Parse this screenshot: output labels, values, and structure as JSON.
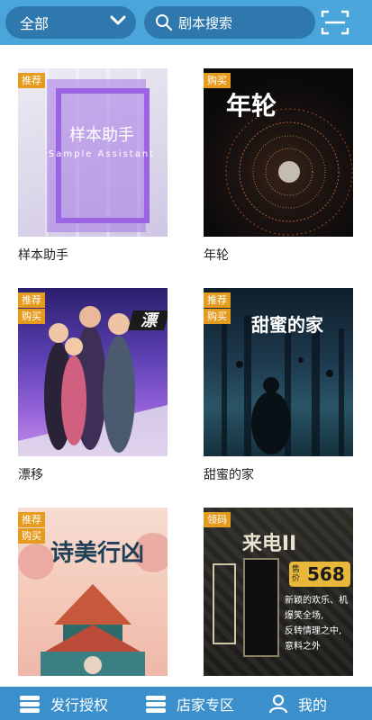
{
  "header": {
    "category_label": "全部",
    "search_placeholder": "剧本搜索"
  },
  "cards": [
    {
      "title": "样本助手",
      "tags": [
        "推荐"
      ],
      "cover_title": "样本助手",
      "cover_subtitle": "Sample Assistant"
    },
    {
      "title": "年轮",
      "tags": [
        "购买"
      ],
      "cover_title": "年轮"
    },
    {
      "title": "漂移",
      "tags": [
        "推荐",
        "购买"
      ],
      "cover_title": "漂"
    },
    {
      "title": "甜蜜的家",
      "tags": [
        "推荐",
        "购买"
      ],
      "cover_title": "甜蜜的家"
    },
    {
      "title": "",
      "tags": [
        "推荐",
        "购买"
      ],
      "cover_title": "诗美行凶"
    },
    {
      "title": "",
      "tags": [
        "领码"
      ],
      "cover_title": "来电II",
      "price_label": "售价",
      "price": "568",
      "slogan": [
        "新颖的欢乐、机",
        "爆笑全场,",
        "反转情理之中,",
        "意料之外"
      ]
    }
  ],
  "nav": {
    "items": [
      {
        "label": "发行授权"
      },
      {
        "label": "店家专区"
      },
      {
        "label": "我的"
      }
    ]
  },
  "colors": {
    "header_bg": "#4aa5db",
    "pill_bg": "#2e78ad",
    "tag_bg": "#e49b1e",
    "nav_bg": "#3b90cc"
  }
}
